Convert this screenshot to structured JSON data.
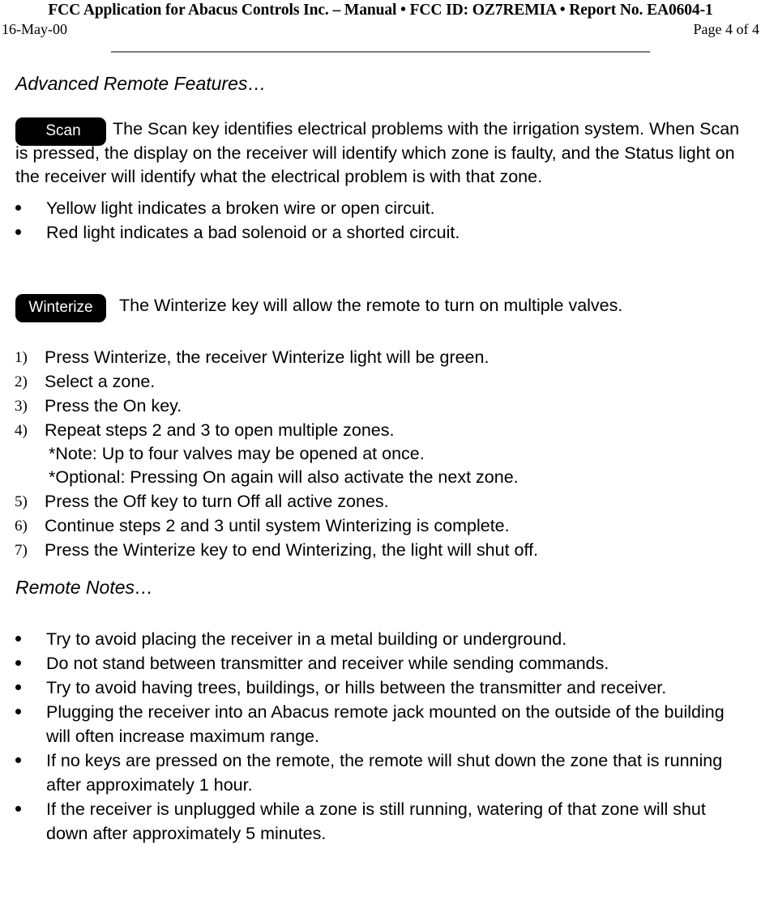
{
  "header": {
    "title": "FCC Application for Abacus Controls Inc. – Manual  • FCC ID: OZ7REMIA  •  Report No. EA0604-1",
    "date": "16-May-00",
    "page_label": "Page 4 of 4"
  },
  "sections": {
    "advanced": {
      "heading": "Advanced Remote Features…",
      "scan_key_label": "Scan",
      "scan_paragraph": "The Scan key identifies electrical problems with the irrigation system. When Scan is pressed, the display on the receiver will identify which zone is faulty, and the Status light on the receiver will identify what the electrical problem is with that zone.",
      "scan_bullets": [
        "Yellow light indicates a broken wire or open circuit.",
        "Red light indicates a bad solenoid or a shorted circuit."
      ],
      "winterize_key_label": "Winterize",
      "winterize_paragraph": "The Winterize key will allow the remote to turn on multiple valves.",
      "winterize_steps": [
        {
          "marker": "1)",
          "text": "Press Winterize, the receiver Winterize light will be green."
        },
        {
          "marker": "2)",
          "text": "Select a zone."
        },
        {
          "marker": "3)",
          "text": "Press the On key."
        },
        {
          "marker": "4)",
          "text": "Repeat steps 2 and 3 to open multiple zones."
        },
        {
          "marker": "5)",
          "text": "Press the Off key to turn Off all active zones."
        },
        {
          "marker": "6)",
          "text": "Continue steps 2 and 3 until system Winterizing is complete."
        },
        {
          "marker": "7)",
          "text": "Press the Winterize key to end Winterizing, the light will shut off."
        }
      ],
      "winterize_sub_notes": [
        "*Note: Up to four valves may be opened at once.",
        "*Optional: Pressing On again will also activate the next zone."
      ]
    },
    "remote_notes": {
      "heading": "Remote Notes…",
      "bullets": [
        "Try to avoid placing the receiver in a metal building or underground.",
        "Do not stand between transmitter and receiver while sending commands.",
        "Try to avoid having trees, buildings, or hills between the transmitter and receiver.",
        "Plugging the receiver into an Abacus remote jack mounted on the outside of the building will often increase maximum range.",
        "If no keys are pressed on the remote, the remote will shut down the zone that is running after approximately 1 hour.",
        "If the receiver is unplugged while a zone is still running, watering of that zone will shut down after approximately 5 minutes."
      ]
    }
  }
}
